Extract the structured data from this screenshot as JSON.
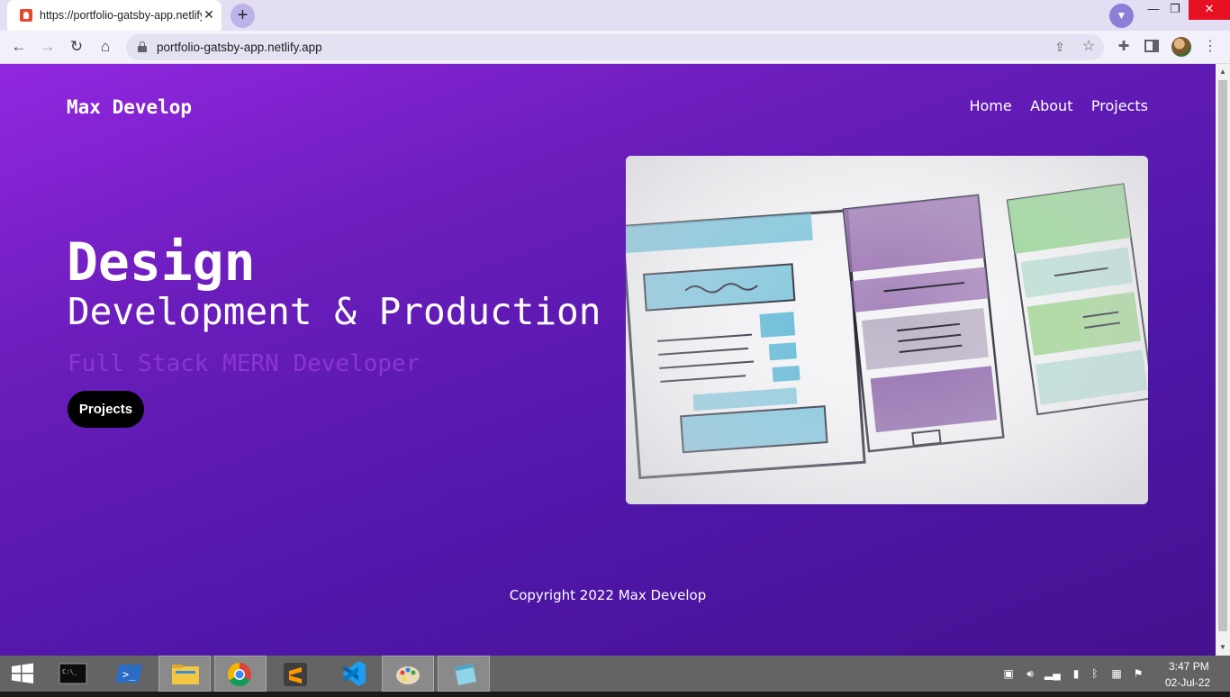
{
  "browser": {
    "tab_title": "https://portfolio-gatsby-app.netlify.app",
    "tab_close": "✕",
    "new_tab": "+",
    "url": "portfolio-gatsby-app.netlify.app",
    "window_controls": {
      "minimize": "—",
      "maximize": "❐",
      "close": "✕"
    }
  },
  "site": {
    "brand": "Max Develop",
    "nav": [
      "Home",
      "About",
      "Projects"
    ],
    "hero": {
      "heading": "Design",
      "subheading": "Development & Production",
      "role": "Full Stack MERN Developer",
      "button_label": "Projects"
    },
    "footer": "Copyright 2022 Max Develop",
    "colors": {
      "gradient_start": "#9227e0",
      "gradient_end": "#45128f",
      "role_text": "#8a35d6",
      "button_bg": "#000000"
    }
  },
  "taskbar": {
    "apps": [
      "Command Prompt",
      "PowerShell",
      "File Explorer",
      "Google Chrome",
      "Sublime Text",
      "Visual Studio Code",
      "Paint",
      "Notepad"
    ],
    "clock": {
      "time": "3:47 PM",
      "date": "02-Jul-22"
    }
  }
}
